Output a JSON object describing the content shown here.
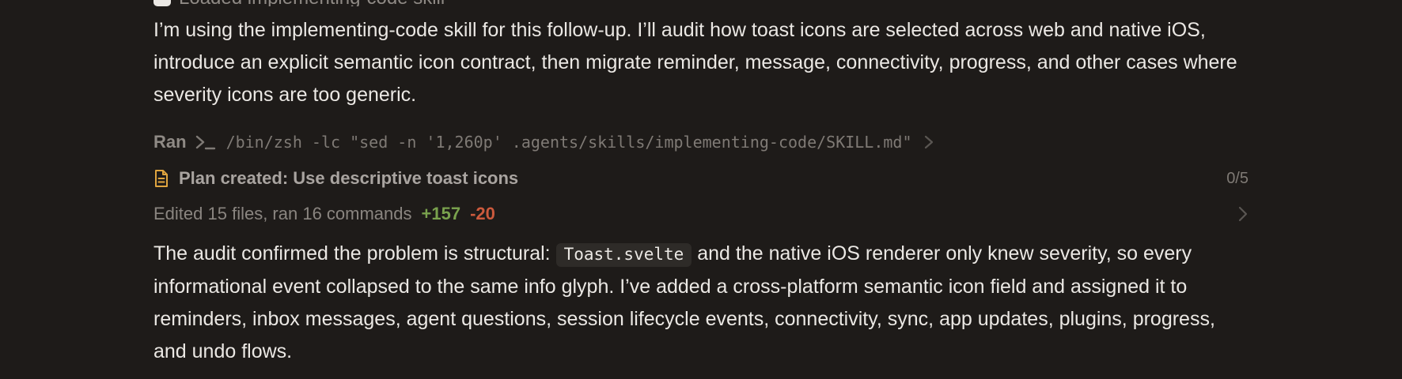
{
  "top_fragment": {
    "text": "Loaded implementing-code skill"
  },
  "intro": {
    "text": "I’m using the implementing-code skill for this follow-up. I’ll audit how toast icons are selected across web and native iOS, introduce an explicit semantic icon contract, then migrate reminder, message, connectivity, progress, and other cases where severity icons are too generic."
  },
  "ran": {
    "label": "Ran",
    "command": "/bin/zsh -lc \"sed -n '1,260p' .agents/skills/implementing-code/SKILL.md\""
  },
  "plan": {
    "title": "Plan created: Use descriptive toast icons",
    "progress": "0/5"
  },
  "edits": {
    "summary": "Edited 15 files, ran 16 commands",
    "added": "+157",
    "removed": "-20"
  },
  "result": {
    "before_code": "The audit confirmed the problem is structural:",
    "code": "Toast.svelte",
    "after_code": "and the native iOS renderer only knew severity, so every informational event collapsed to the same info glyph. I’ve added a cross-platform semantic icon field and assigned it to reminders, inbox messages, agent questions, session lifecycle events, connectivity, sync, app updates, plugins, progress, and undo flows."
  },
  "colors": {
    "background": "#1e1b19",
    "text": "#ebe8e4",
    "muted": "#8f8a85",
    "accent_doc": "#e0a53f",
    "added": "#79a14d",
    "removed": "#cc5a3d"
  },
  "icons": {
    "terminal": "terminal-icon",
    "chevron": "chevron-right-icon",
    "document": "document-icon"
  }
}
